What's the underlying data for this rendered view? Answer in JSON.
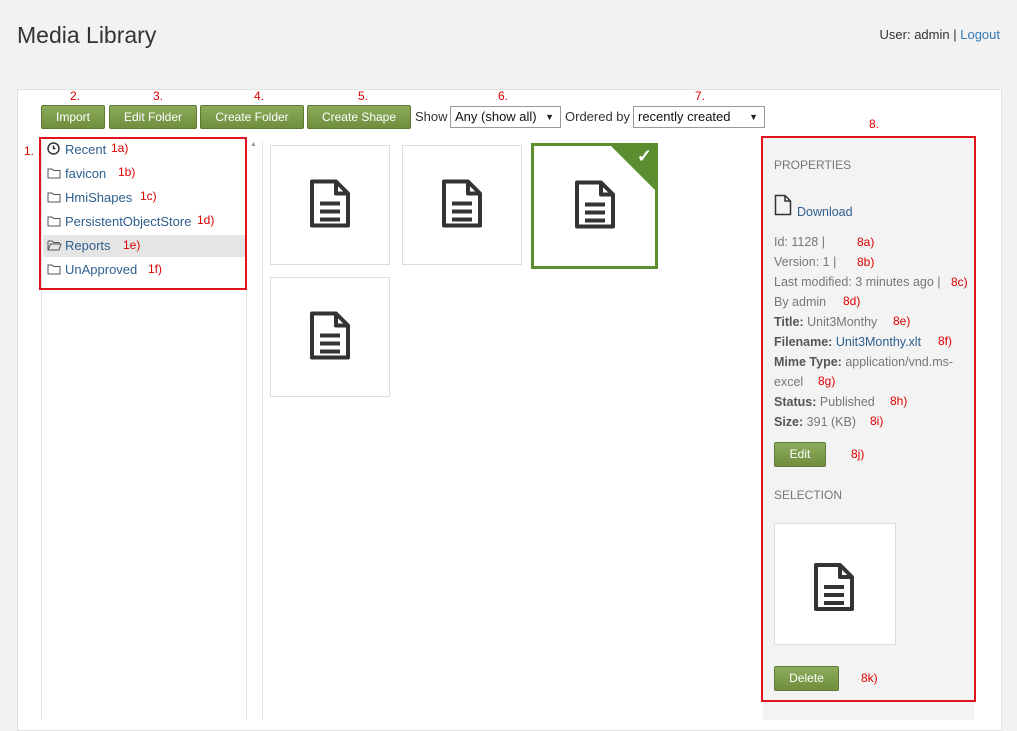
{
  "page": {
    "title": "Media Library"
  },
  "user": {
    "prefix": "User: admin |",
    "logout": "Logout"
  },
  "annotations": {
    "n1": "1.",
    "n2": "2.",
    "n3": "3.",
    "n4": "4.",
    "n5": "5.",
    "n6": "6.",
    "n7": "7.",
    "n8": "8.",
    "a1": "1a)",
    "b1": "1b)",
    "c1": "1c)",
    "d1": "1d)",
    "e1": "1e)",
    "f1": "1f)",
    "a8": "8a)",
    "b8": "8b)",
    "c8": "8c)",
    "d8": "8d)",
    "e8": "8e)",
    "f8": "8f)",
    "g8": "8g)",
    "h8": "8h)",
    "i8": "8i)",
    "j8": "8j)",
    "k8": "8k)"
  },
  "toolbar": {
    "import": "Import",
    "edit_folder": "Edit Folder",
    "create_folder": "Create Folder",
    "create_shape": "Create Shape",
    "show_label": "Show",
    "show_value": "Any (show all)",
    "order_label": "Ordered by",
    "order_value": "recently created"
  },
  "tree": {
    "items": [
      {
        "label": "Recent",
        "icon": "clock-icon"
      },
      {
        "label": "favicon",
        "icon": "folder-icon"
      },
      {
        "label": "HmiShapes",
        "icon": "folder-icon"
      },
      {
        "label": "PersistentObjectStore",
        "icon": "folder-icon"
      },
      {
        "label": "Reports",
        "icon": "folder-open-icon",
        "active": true
      },
      {
        "label": "UnApproved",
        "icon": "folder-icon"
      }
    ]
  },
  "properties": {
    "heading": "PROPERTIES",
    "download": "Download",
    "id": "Id: 1128 |",
    "version": "Version: 1  |",
    "last_modified": "Last modified: 3 minutes ago |",
    "by": "By admin",
    "title_label": "Title:",
    "title_value": "Unit3Monthy",
    "filename_label": "Filename:",
    "filename_value": "Unit3Monthy.xlt",
    "mime_label": "Mime Type:",
    "mime_value_1": "application/vnd.ms-",
    "mime_value_2": "excel",
    "status_label": "Status:",
    "status_value": "Published",
    "size_label": "Size:",
    "size_value": "391 (KB)",
    "edit": "Edit",
    "selection_heading": "SELECTION",
    "delete": "Delete"
  },
  "colors": {
    "accent": "#6f8f3f",
    "annotation": "#e1131f",
    "link": "#2e5f8e"
  }
}
